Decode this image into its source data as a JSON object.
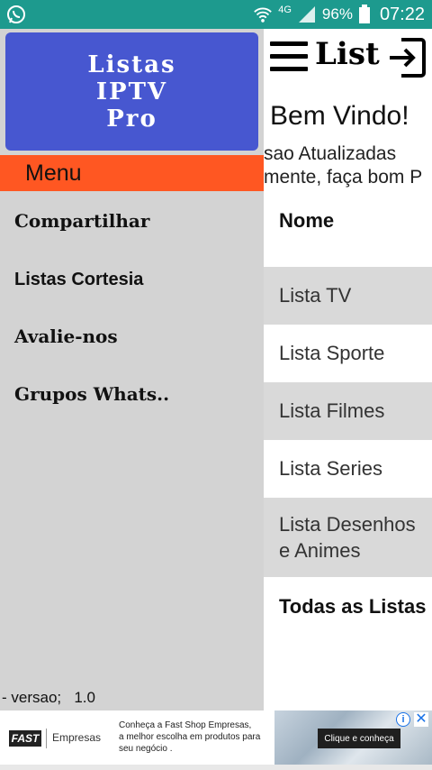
{
  "status_bar": {
    "network": "4G",
    "battery": "96%",
    "time": "07:22",
    "icons": [
      "whatsapp-icon",
      "wifi-icon",
      "signal-icon",
      "battery-icon"
    ]
  },
  "toolbar": {
    "title": "List",
    "icons": [
      "hamburger-icon",
      "exit-icon"
    ]
  },
  "main": {
    "welcome": "Bem Vindo!",
    "subtitle_lines": [
      "sao Atualizadas",
      "mente, faça bom P"
    ],
    "list_header": "Nome",
    "items": [
      {
        "label": "Lista TV"
      },
      {
        "label": "Lista Sporte"
      },
      {
        "label": "Lista Filmes"
      },
      {
        "label": "Lista Series"
      },
      {
        "label_line1": "Lista Desenhos",
        "label_line2": "e Animes"
      }
    ],
    "footer": "Todas as Listas"
  },
  "drawer": {
    "logo_lines": [
      "Listas",
      "IPTV",
      "Pro"
    ],
    "menu_header": "Menu",
    "items": [
      "Compartilhar",
      "Listas Cortesia",
      "Avalie-nos",
      "Grupos Whats.."
    ],
    "version_label": "- versao;",
    "version_number": "1.0"
  },
  "ad": {
    "logo_text": "FAST",
    "brand": "Empresas",
    "text_lines": [
      "Conheça a Fast Shop Empresas,",
      "a melhor escolha em produtos para",
      "seu negócio ."
    ],
    "cta": "Clique e conheça",
    "info_icon": "info-icon",
    "close_icon": "close-icon"
  },
  "colors": {
    "status_bar": "#1d9a8e",
    "logo_bg": "#4757d0",
    "menu_header": "#ff5722",
    "drawer_bg": "#d3d3d3",
    "row_gray": "#d9d9d9"
  }
}
